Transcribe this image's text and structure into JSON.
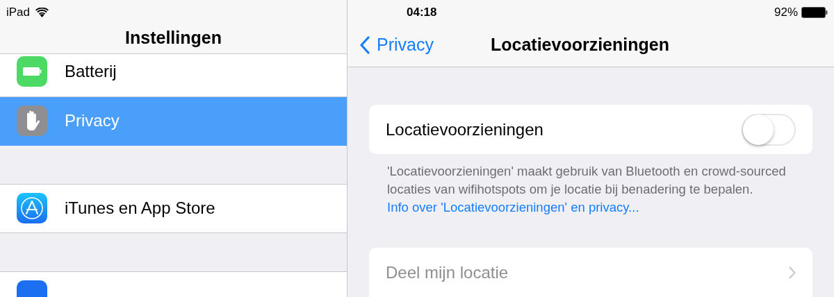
{
  "status_bar": {
    "device": "iPad",
    "time": "04:18",
    "battery": "92%"
  },
  "sidebar": {
    "title": "Instellingen",
    "groups": [
      [
        {
          "kind": "battery",
          "label": "Batterij",
          "selected": false
        },
        {
          "kind": "hand",
          "label": "Privacy",
          "selected": true
        }
      ],
      [
        {
          "kind": "appstore",
          "label": "iTunes en App Store",
          "selected": false
        }
      ],
      [
        {
          "kind": "blank",
          "selected": false
        }
      ]
    ]
  },
  "detail": {
    "back": "Privacy",
    "title": "Locatievoorzieningen",
    "toggle": {
      "label": "Locatievoorzieningen",
      "on": false
    },
    "footer": {
      "text": "'Locatievoorzieningen' maakt gebruik van Bluetooth en crowd-sourced locaties van wifihotspots om je locatie bij benadering te bepalen.",
      "link": "Info over 'Locatievoorzieningen' en privacy..."
    },
    "share": {
      "label": "Deel mijn locatie",
      "disabled": true
    }
  }
}
